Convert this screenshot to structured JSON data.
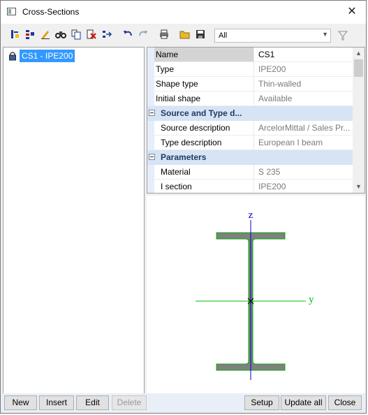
{
  "window": {
    "title": "Cross-Sections",
    "close_glyph": "✕"
  },
  "toolbar": {
    "icons": [
      "new-icon",
      "insert-icon",
      "edit-icon",
      "find-icon",
      "copy-icon",
      "delete-icon",
      "properties-icon",
      "undo-icon",
      "redo-icon",
      "print-icon",
      "open-icon",
      "save-icon"
    ],
    "filter_value": "All",
    "filter_arrow": "▼"
  },
  "tree": {
    "items": [
      {
        "label": "CS1 - IPE200",
        "icon": "lock-icon"
      }
    ]
  },
  "properties": {
    "rows": [
      {
        "kind": "row",
        "name": "Name",
        "value": "CS1",
        "selected": true
      },
      {
        "kind": "row",
        "name": "Type",
        "value": "IPE200"
      },
      {
        "kind": "row",
        "name": "Shape type",
        "value": "Thin-walled"
      },
      {
        "kind": "row",
        "name": "Initial shape",
        "value": "Available"
      },
      {
        "kind": "category",
        "name": "Source and Type d..."
      },
      {
        "kind": "row",
        "name": "Source description",
        "value": "ArcelorMittal / Sales Pr...",
        "indent": true
      },
      {
        "kind": "row",
        "name": "Type description",
        "value": "European I beam",
        "indent": true
      },
      {
        "kind": "category",
        "name": "Parameters"
      },
      {
        "kind": "row",
        "name": "Material",
        "value": "S 235",
        "indent": true
      },
      {
        "kind": "row",
        "name": "I section",
        "value": "IPE200",
        "indent": true
      }
    ],
    "scroll_up": "▲",
    "scroll_down": "▼"
  },
  "preview": {
    "z_label": "z",
    "y_label": "y",
    "section_fill": "#808080",
    "section_stroke": "#00b000",
    "axis_color": "#0000cc"
  },
  "buttons": {
    "new": "New",
    "insert": "Insert",
    "edit": "Edit",
    "delete": "Delete",
    "setup": "Setup",
    "update_all": "Update all",
    "close": "Close"
  }
}
